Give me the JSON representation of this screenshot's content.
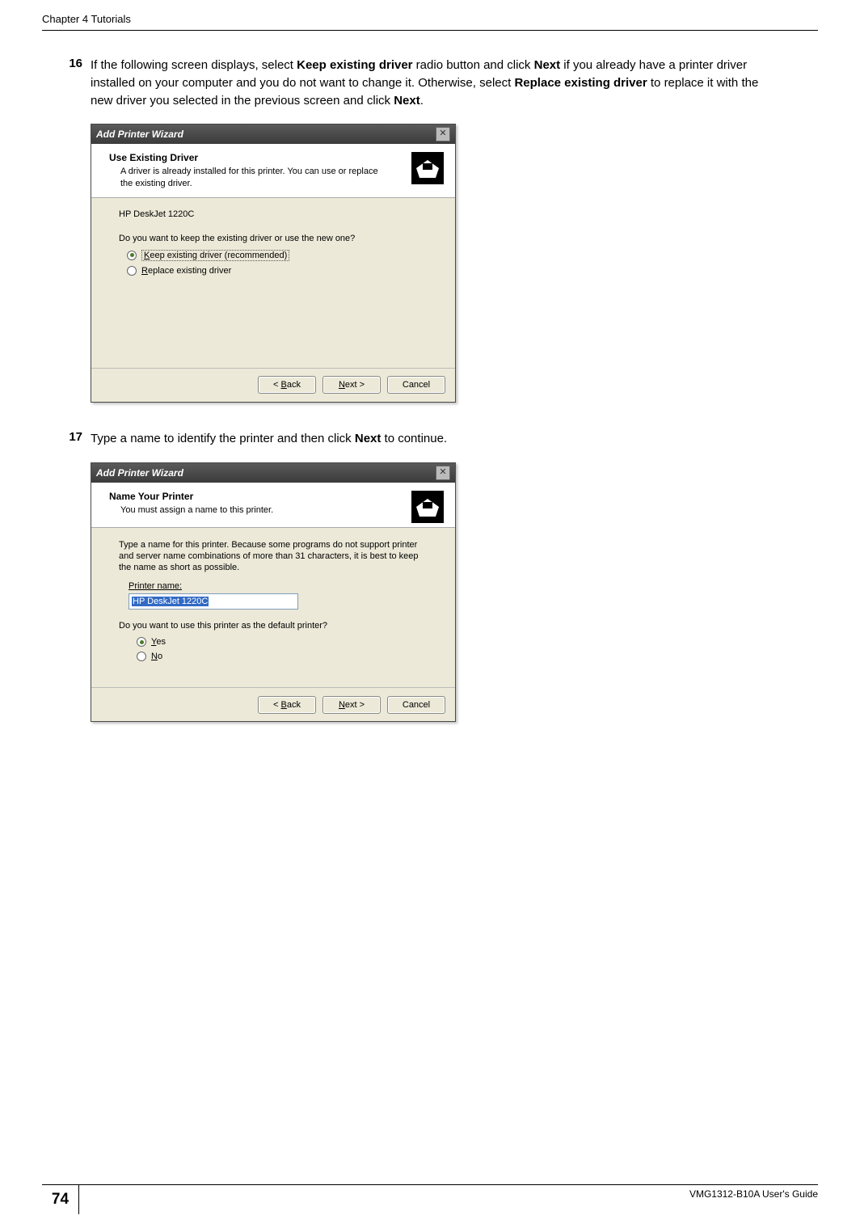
{
  "page": {
    "chapter_header": "Chapter 4 Tutorials",
    "page_number": "74",
    "guide_name": "VMG1312-B10A User's Guide"
  },
  "steps": {
    "s16": {
      "num": "16",
      "prefix": "If the following screen displays, select ",
      "b1": "Keep existing driver",
      "mid1": " radio button and click ",
      "b2": "Next",
      "mid2": " if you already have a printer driver installed on your computer and you do not want to change it. Otherwise, select ",
      "b3": "Replace existing driver",
      "mid3": " to replace it with the new driver you selected in the previous screen and click ",
      "b4": "Next",
      "suffix": "."
    },
    "s17": {
      "num": "17",
      "prefix": "Type a name to identify the printer and then click ",
      "b1": "Next",
      "suffix": " to continue."
    }
  },
  "dialog1": {
    "title": "Add Printer Wizard",
    "header_title": "Use Existing Driver",
    "header_sub": "A driver is already installed for this printer. You can use or replace the existing driver.",
    "printer_model": "HP DeskJet 1220C",
    "question": "Do you want to keep the existing driver or use the new one?",
    "radio_keep_pre": "K",
    "radio_keep_rest": "eep existing driver (recommended)",
    "radio_replace_pre": "R",
    "radio_replace_rest": "eplace existing driver",
    "btn_back_pre": "< ",
    "btn_back_u": "B",
    "btn_back_rest": "ack",
    "btn_next_u": "N",
    "btn_next_rest": "ext >",
    "btn_cancel": "Cancel"
  },
  "dialog2": {
    "title": "Add Printer Wizard",
    "header_title": "Name Your Printer",
    "header_sub": "You must assign a name to this printer.",
    "paragraph": "Type a name for this printer. Because some programs do not support printer and server name combinations of more than 31 characters, it is best to keep the name as short as possible.",
    "field_label_pre": "P",
    "field_label_rest": "rinter name:",
    "input_value": "HP DeskJet 1220C",
    "question": "Do you want to use this printer as the default printer?",
    "radio_yes_u": "Y",
    "radio_yes_rest": "es",
    "radio_no_u": "N",
    "radio_no_rest": "o",
    "btn_back_pre": "< ",
    "btn_back_u": "B",
    "btn_back_rest": "ack",
    "btn_next_u": "N",
    "btn_next_rest": "ext >",
    "btn_cancel": "Cancel"
  }
}
